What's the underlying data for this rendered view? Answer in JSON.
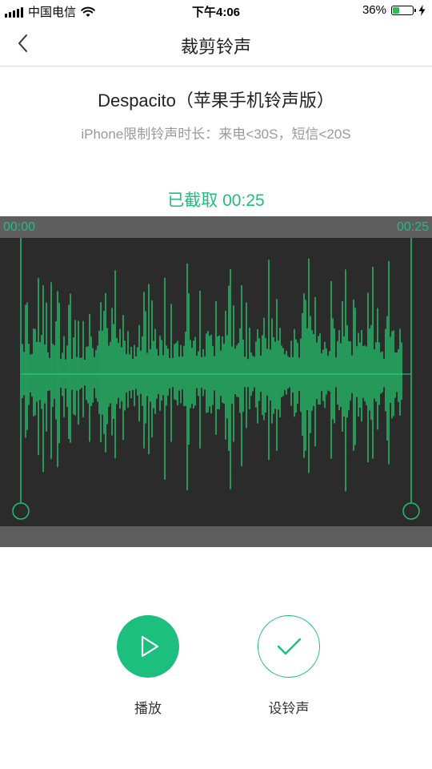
{
  "status_bar": {
    "carrier": "中国电信",
    "time": "下午4:06",
    "battery_percent": "36%",
    "battery_level": 0.36
  },
  "nav": {
    "title": "裁剪铃声",
    "back_icon": "chevron-left-icon"
  },
  "song": {
    "title": "Despacito（苹果手机铃声版）",
    "hint": "iPhone限制铃声时长：来电<30S，短信<20S"
  },
  "clip": {
    "status": "已截取 00:25",
    "start_time": "00:00",
    "end_time": "00:25"
  },
  "actions": {
    "play_label": "播放",
    "set_label": "设铃声"
  },
  "colors": {
    "accent": "#1dbf7f",
    "waveform": "#22e07a",
    "wave_background": "#2b2b2b",
    "strip": "#5e5e5e"
  }
}
